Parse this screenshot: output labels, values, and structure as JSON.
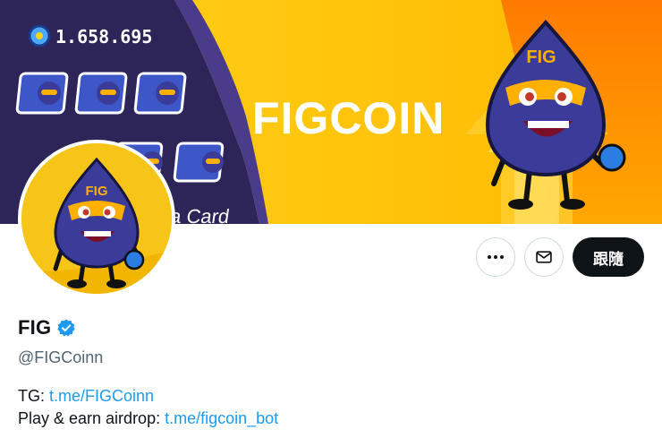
{
  "banner": {
    "title": "FIGCOIN",
    "score": "1.658.695",
    "mascot_label": "FIG",
    "partial_text": "t a Card"
  },
  "profile": {
    "display_name": "FIG",
    "handle": "@FIGCoinn",
    "verified": true
  },
  "actions": {
    "more_icon": "more-horizontal-icon",
    "message_icon": "envelope-icon",
    "follow_label": "跟隨"
  },
  "bio": {
    "line1_prefix": "TG:",
    "line1_link": "t.me/FIGCoinn",
    "line2_prefix": "Play & earn airdrop:",
    "line2_link": "t.me/figcoin_bot"
  },
  "colors": {
    "accent": "#1d9bf0",
    "banner_yellow": "#ffc60b",
    "banner_purple": "#2d2458",
    "mascot": "#3b3b9a",
    "follow_bg": "#0f1419"
  }
}
